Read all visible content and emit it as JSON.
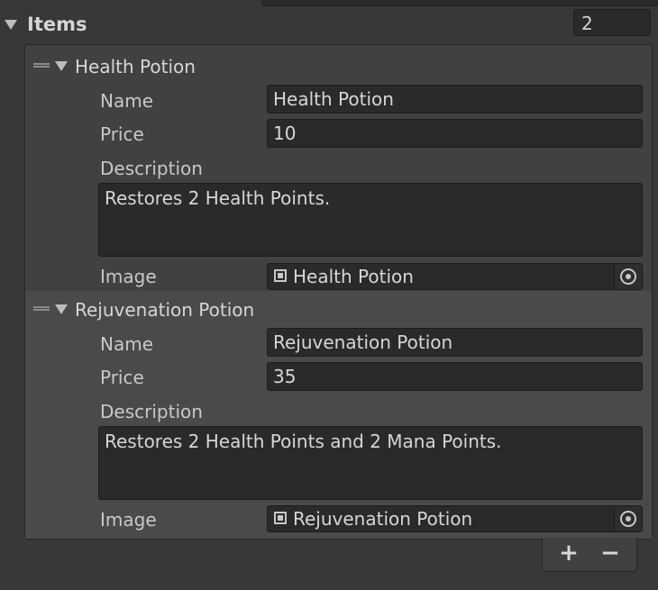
{
  "items": {
    "title": "Items",
    "count": "2"
  },
  "elements": [
    {
      "title": "Health Potion",
      "name_label": "Name",
      "name_value": "Health Potion",
      "price_label": "Price",
      "price_value": "10",
      "description_label": "Description",
      "description_value": "Restores 2 Health Points.",
      "image_label": "Image",
      "image_value": "Health Potion"
    },
    {
      "title": "Rejuvenation Potion",
      "name_label": "Name",
      "name_value": "Rejuvenation Potion",
      "price_label": "Price",
      "price_value": "35",
      "description_label": "Description",
      "description_value": "Restores 2 Health Points and 2 Mana Points.",
      "image_label": "Image",
      "image_value": "Rejuvenation Potion"
    }
  ],
  "footer": {
    "add_label": "+",
    "remove_label": "−"
  },
  "icons": {
    "foldout": "triangle-down-icon",
    "drag": "drag-handle-icon",
    "sprite": "sprite-icon",
    "object_picker": "object-picker-icon"
  }
}
